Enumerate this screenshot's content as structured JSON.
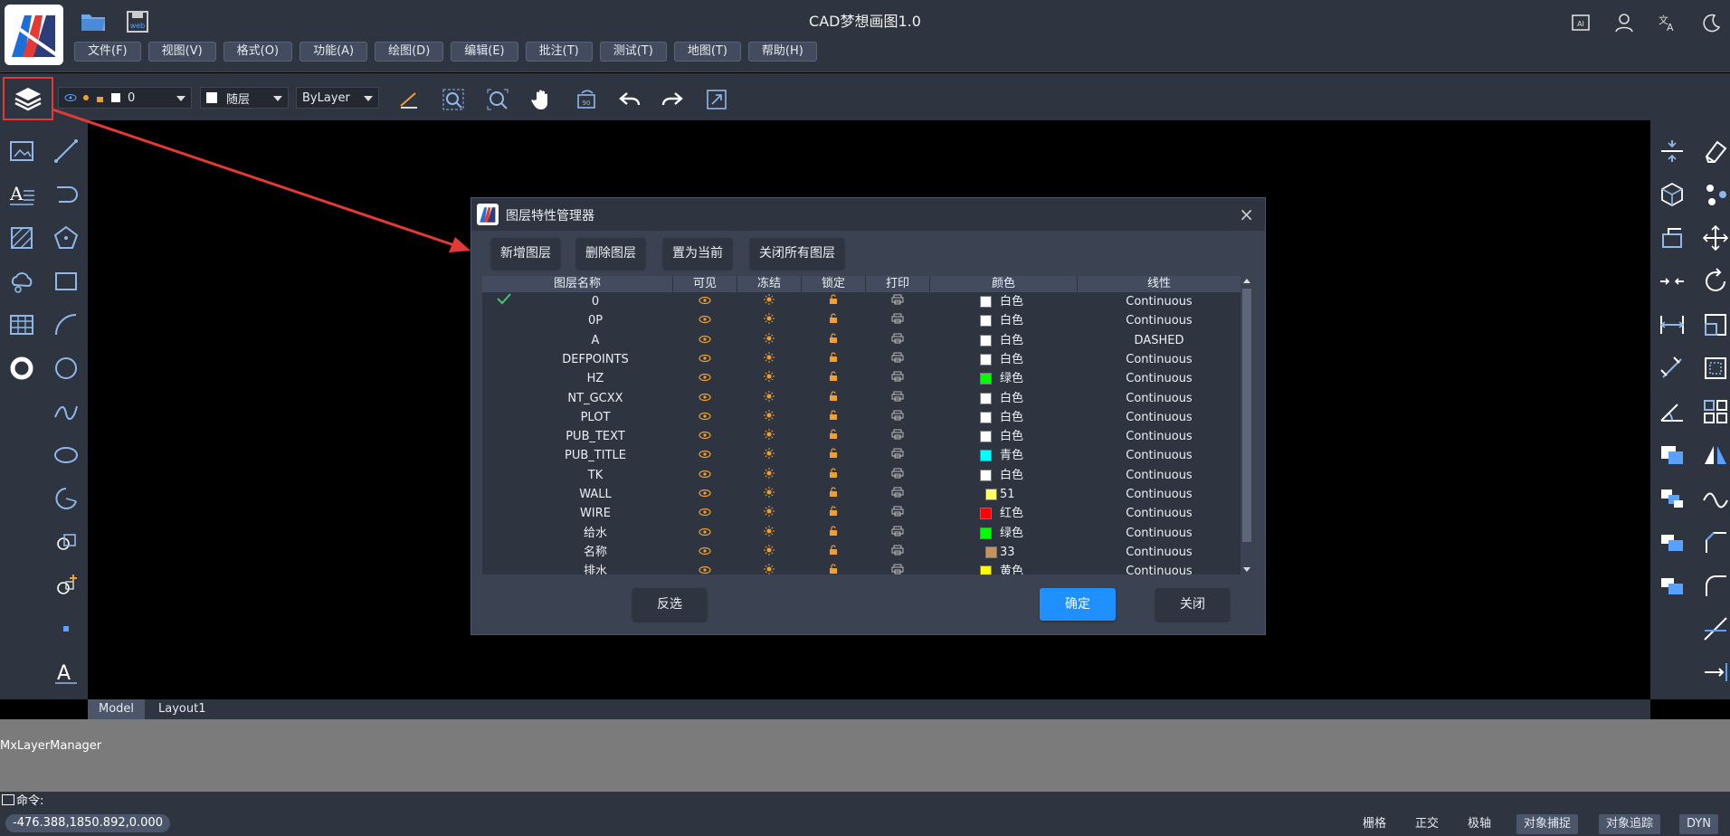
{
  "app": {
    "title": "CAD梦想画图1.0"
  },
  "menu": [
    "文件(F)",
    "视图(V)",
    "格式(O)",
    "功能(A)",
    "绘图(D)",
    "编辑(E)",
    "批注(T)",
    "测试(T)",
    "地图(T)",
    "帮助(H)"
  ],
  "toolbar": {
    "layer_value": "0",
    "color_value": "随层",
    "linetype_value": "ByLayer"
  },
  "tabs": {
    "model": "Model",
    "layout1": "Layout1"
  },
  "command": {
    "output": "MxLayerManager",
    "prompt": "命令:"
  },
  "status": {
    "coords": "-476.388,1850.892,0.000",
    "grid": "栅格",
    "ortho": "正交",
    "polar": "极轴",
    "osnap": "对象捕捉",
    "otrack": "对象追踪",
    "dyn": "DYN"
  },
  "dialog": {
    "title": "图层特性管理器",
    "buttons": {
      "new": "新增图层",
      "delete": "删除图层",
      "set_current": "置为当前",
      "close_all": "关闭所有图层"
    },
    "columns": [
      "图层名称",
      "可见",
      "冻结",
      "锁定",
      "打印",
      "颜色",
      "线性"
    ],
    "rows": [
      {
        "name": "0",
        "color_name": "白色",
        "color_hex": "#ffffff",
        "linetype": "Continuous",
        "current": true
      },
      {
        "name": "0P",
        "color_name": "白色",
        "color_hex": "#ffffff",
        "linetype": "Continuous"
      },
      {
        "name": "A",
        "color_name": "白色",
        "color_hex": "#ffffff",
        "linetype": "DASHED"
      },
      {
        "name": "DEFPOINTS",
        "color_name": "白色",
        "color_hex": "#ffffff",
        "linetype": "Continuous"
      },
      {
        "name": "HZ",
        "color_name": "绿色",
        "color_hex": "#00ff00",
        "linetype": "Continuous"
      },
      {
        "name": "NT_GCXX",
        "color_name": "白色",
        "color_hex": "#ffffff",
        "linetype": "Continuous"
      },
      {
        "name": "PLOT",
        "color_name": "白色",
        "color_hex": "#ffffff",
        "linetype": "Continuous"
      },
      {
        "name": "PUB_TEXT",
        "color_name": "白色",
        "color_hex": "#ffffff",
        "linetype": "Continuous"
      },
      {
        "name": "PUB_TITLE",
        "color_name": "青色",
        "color_hex": "#00ffff",
        "linetype": "Continuous"
      },
      {
        "name": "TK",
        "color_name": "白色",
        "color_hex": "#ffffff",
        "linetype": "Continuous"
      },
      {
        "name": "WALL",
        "color_name": "51",
        "color_hex": "#ffff66",
        "linetype": "Continuous"
      },
      {
        "name": "WIRE",
        "color_name": "红色",
        "color_hex": "#ff0000",
        "linetype": "Continuous"
      },
      {
        "name": "给水",
        "color_name": "绿色",
        "color_hex": "#00ff00",
        "linetype": "Continuous"
      },
      {
        "name": "名称",
        "color_name": "33",
        "color_hex": "#c8915a",
        "linetype": "Continuous"
      },
      {
        "name": "排水",
        "color_name": "黄色",
        "color_hex": "#ffff00",
        "linetype": "Continuous"
      }
    ],
    "footer": {
      "invert": "反选",
      "ok": "确定",
      "close": "关闭"
    }
  },
  "colors": {
    "accent": "#1e90ff",
    "panel": "#2e3440",
    "icon_blue": "#8fb8e8",
    "icon_orange": "#f0a030",
    "annotation_red": "#e53935"
  },
  "icons": [
    "layers-icon",
    "open-folder-icon",
    "save-web-icon",
    "ai-icon",
    "user-icon",
    "translate-icon",
    "dark-mode-icon"
  ]
}
